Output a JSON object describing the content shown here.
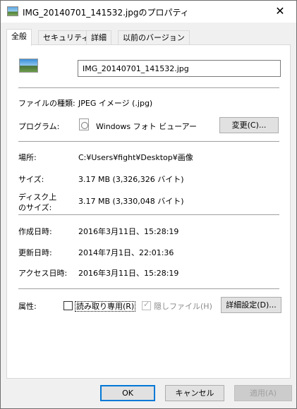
{
  "window": {
    "title": "IMG_20140701_141532.jpgのプロパティ",
    "close_glyph": "✕"
  },
  "tabs": [
    {
      "label": "全般",
      "active": true
    },
    {
      "label": "セキュリティ",
      "active": false
    },
    {
      "label": "詳細",
      "active": false
    },
    {
      "label": "以前のバージョン",
      "active": false
    }
  ],
  "general": {
    "file_name": "IMG_20140701_141532.jpg",
    "file_type_label": "ファイルの種類:",
    "file_type_value": "JPEG イメージ (.jpg)",
    "program_label": "プログラム:",
    "program_value": "Windows フォト ビューアー",
    "change_button": "変更(C)...",
    "location_label": "場所:",
    "location_value": "C:¥Users¥fight¥Desktop¥画像",
    "size_label": "サイズ:",
    "size_value": "3.17 MB (3,326,326 バイト)",
    "disk_size_label_line1": "ディスク上",
    "disk_size_label_line2": "のサイズ:",
    "disk_size_value": "3.17 MB (3,330,048 バイト)",
    "created_label": "作成日時:",
    "created_value": "2016年3月11日、15:28:19",
    "modified_label": "更新日時:",
    "modified_value": "2014年7月1日、22:01:36",
    "accessed_label": "アクセス日時:",
    "accessed_value": "2016年3月11日、15:28:19",
    "attributes_label": "属性:",
    "readonly_label": "読み取り専用(R)",
    "hidden_label": "隠しファイル(H)",
    "advanced_button": "詳細設定(D)..."
  },
  "buttons": {
    "ok": "OK",
    "cancel": "キャンセル",
    "apply": "適用(A)"
  },
  "icons": {
    "title": "image-file-icon",
    "file": "image-file-icon",
    "program": "photo-viewer-icon"
  }
}
